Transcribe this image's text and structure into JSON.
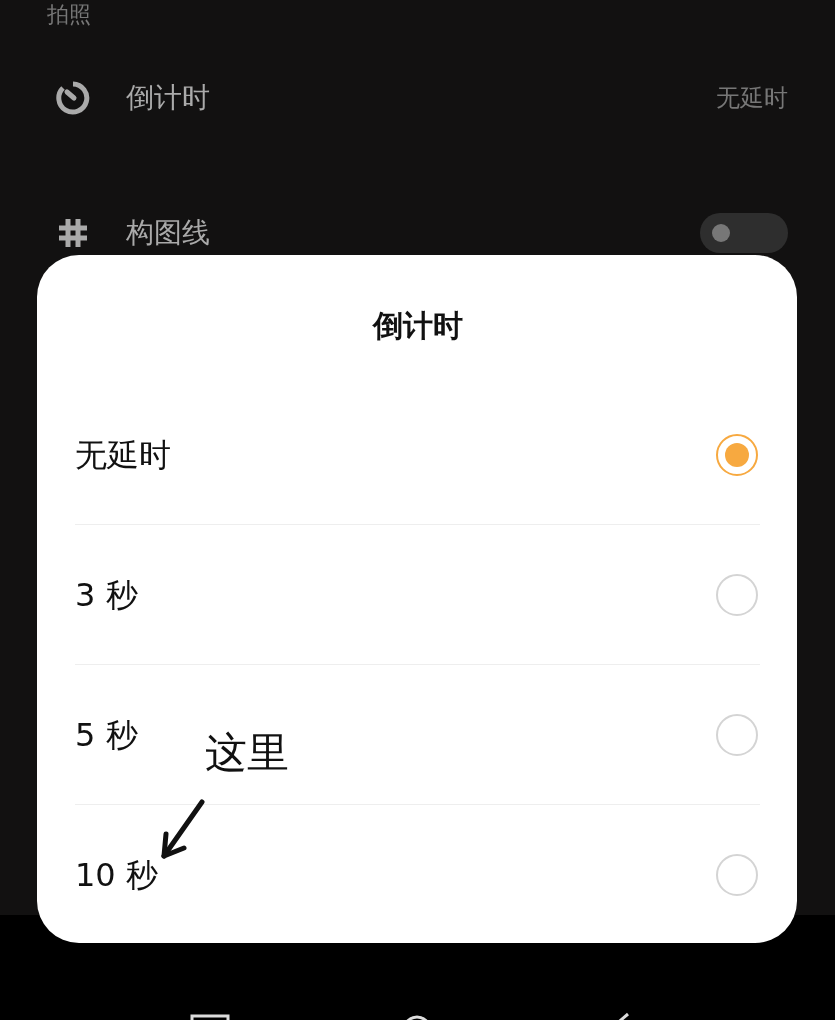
{
  "section_header": "拍照",
  "settings": [
    {
      "kind": "value",
      "label": "倒计时",
      "value": "无延时"
    },
    {
      "kind": "toggle",
      "label": "构图线",
      "on": false
    }
  ],
  "dialog": {
    "title": "倒计时",
    "options": [
      {
        "label": "无延时",
        "selected": true
      },
      {
        "label": "3 秒",
        "selected": false
      },
      {
        "label": "5 秒",
        "selected": false
      },
      {
        "label": "10 秒",
        "selected": false
      }
    ]
  },
  "annotation": {
    "text": "这里"
  }
}
